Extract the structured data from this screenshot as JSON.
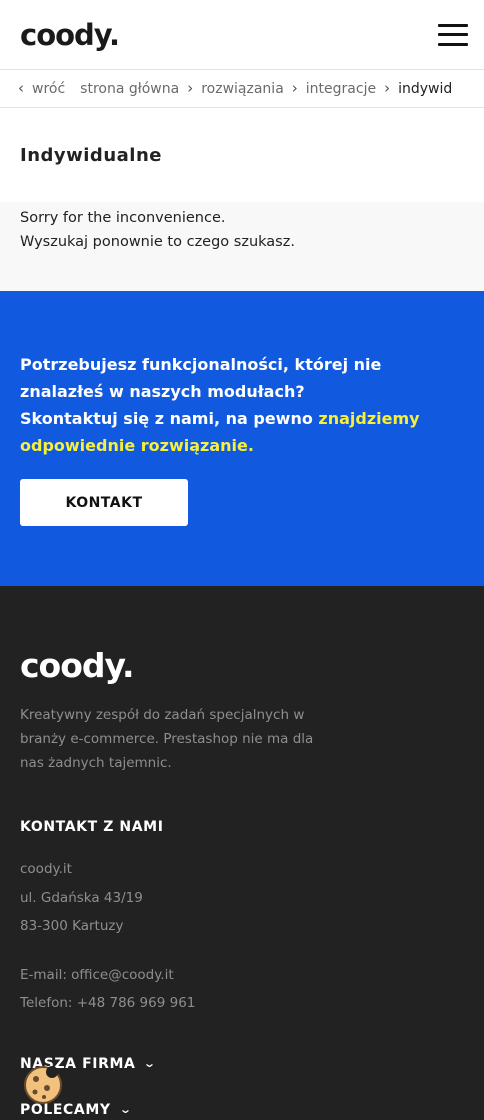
{
  "header": {
    "logo": "coody."
  },
  "breadcrumb": {
    "back": "wróć",
    "items": [
      "strona główna",
      "rozwiązania",
      "integracje"
    ],
    "current": "indywid"
  },
  "page": {
    "title": "Indywidualne"
  },
  "message": {
    "line1": "Sorry for the inconvenience.",
    "line2": "Wyszukaj ponownie to czego szukasz."
  },
  "cta": {
    "line1": "Potrzebujesz funkcjonalności, której nie znalazłeś w naszych modułach?",
    "line2_prefix": "Skontaktuj się z nami, na pewno ",
    "line2_highlight": "znajdziemy odpowiednie rozwiązanie.",
    "button": "KONTAKT",
    "colors": {
      "background": "#115ae0",
      "highlight": "#f7ef3a"
    }
  },
  "footer": {
    "logo": "coody.",
    "description": "Kreatywny zespół do zadań specjalnych w branży e-commerce. Prestashop nie ma dla nas żadnych tajemnic.",
    "contact_heading": "KONTAKT Z NAMI",
    "address": [
      "coody.it",
      "ul. Gdańska 43/19",
      "83-300 Kartuzy"
    ],
    "email": "E-mail: office@coody.it",
    "phone": "Telefon: +48 786 969 961",
    "accordion": [
      "NASZA FIRMA",
      "POLECAMY"
    ]
  },
  "icons": {
    "menu": "hamburger-icon",
    "chevron_left": "chevron-left-icon",
    "chevron_right": "chevron-right-icon",
    "chevron_down": "chevron-down-icon",
    "cookie": "cookie-icon"
  }
}
